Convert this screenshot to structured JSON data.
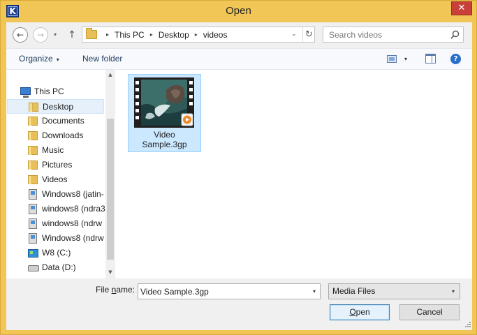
{
  "window": {
    "title": "Open",
    "app_icon_letter": "K",
    "close_symbol": "✕"
  },
  "navigation": {
    "back_symbol": "←",
    "forward_symbol": "→",
    "up_symbol": "↑",
    "recent_symbol": "▾"
  },
  "address": {
    "crumbs": [
      "This PC",
      "Desktop",
      "videos"
    ],
    "separator": "▸",
    "dropdown_symbol": "⌄",
    "refresh_symbol": "↻"
  },
  "search": {
    "placeholder": "Search videos"
  },
  "toolbar": {
    "organize_label": "Organize",
    "organize_caret": "▾",
    "new_folder_label": "New folder",
    "view_caret": "▾",
    "help_symbol": "?"
  },
  "nav_pane": {
    "items": [
      {
        "label": "This PC",
        "icon": "computer-icon"
      },
      {
        "label": "Desktop",
        "icon": "folder-icon",
        "selected": true
      },
      {
        "label": "Documents",
        "icon": "folder-icon"
      },
      {
        "label": "Downloads",
        "icon": "folder-icon"
      },
      {
        "label": "Music",
        "icon": "folder-icon"
      },
      {
        "label": "Pictures",
        "icon": "folder-icon"
      },
      {
        "label": "Videos",
        "icon": "folder-icon"
      },
      {
        "label": "Windows8 (jatin-",
        "icon": "network-drive-icon"
      },
      {
        "label": "windows8 (ndra3",
        "icon": "network-drive-icon"
      },
      {
        "label": "windows8 (ndrw",
        "icon": "network-drive-icon"
      },
      {
        "label": "Windows8 (ndrw",
        "icon": "network-drive-icon"
      },
      {
        "label": "W8 (C:)",
        "icon": "windows-drive-icon"
      },
      {
        "label": "Data (D:)",
        "icon": "drive-icon"
      }
    ],
    "scroll_up_symbol": "▲",
    "scroll_down_symbol": "▼"
  },
  "content": {
    "files": [
      {
        "name_line1": "Video",
        "name_line2": "Sample.3gp",
        "icon": "video-file-icon",
        "selected": true
      }
    ]
  },
  "footer": {
    "file_name_label_prefix": "File ",
    "file_name_label_underlined": "n",
    "file_name_label_suffix": "ame:",
    "file_name_value": "Video Sample.3gp",
    "file_name_caret": "▾",
    "filter_value": "Media Files",
    "filter_caret": "▾",
    "open_underlined": "O",
    "open_rest": "pen",
    "cancel_label": "Cancel"
  },
  "colors": {
    "frame": "#f1c656",
    "close_button": "#c7413a",
    "selection": "#cce8ff",
    "link_text": "#1e395b"
  }
}
